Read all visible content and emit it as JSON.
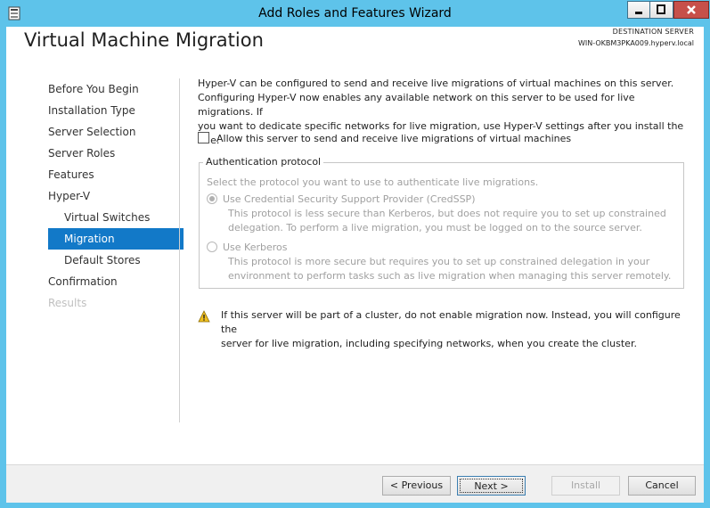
{
  "window": {
    "title": "Add Roles and Features Wizard"
  },
  "header": {
    "page_title": "Virtual Machine Migration",
    "destination_label": "DESTINATION SERVER",
    "destination_server": "WIN-OKBM3PKA009.hyperv.local"
  },
  "nav": {
    "items": [
      {
        "label": "Before You Begin"
      },
      {
        "label": "Installation Type"
      },
      {
        "label": "Server Selection"
      },
      {
        "label": "Server Roles"
      },
      {
        "label": "Features"
      },
      {
        "label": "Hyper-V"
      },
      {
        "label": "Virtual Switches"
      },
      {
        "label": "Migration"
      },
      {
        "label": "Default Stores"
      },
      {
        "label": "Confirmation"
      },
      {
        "label": "Results"
      }
    ]
  },
  "content": {
    "intro_line1": "Hyper-V can be configured to send and receive live migrations of virtual machines on this server.",
    "intro_line2": "Configuring Hyper-V now enables any available network on this server to be used for live migrations. If",
    "intro_line3": "you want to dedicate specific networks for live migration, use Hyper-V settings after you install the role.",
    "allow_label": "Allow this server to send and receive live migrations of virtual machines",
    "allow_checked": false,
    "auth_group_title": "Authentication protocol",
    "auth_group_desc": "Select the protocol you want to use to authenticate live migrations.",
    "credssp_label": "Use Credential Security Support Provider (CredSSP)",
    "credssp_desc1": "This protocol is less secure than Kerberos, but does not require you to set up constrained",
    "credssp_desc2": "delegation. To perform a live migration, you must be logged on to the source server.",
    "kerberos_label": "Use Kerberos",
    "kerberos_desc1": "This protocol is more secure but requires you to set up constrained delegation in your",
    "kerberos_desc2": "environment to perform tasks such as live migration when managing this server remotely.",
    "warning_line1": "If this server will be part of a cluster, do not enable migration now. Instead, you will configure the",
    "warning_line2": "server for live migration, including specifying networks, when you create the cluster."
  },
  "footer": {
    "previous_label": "< Previous",
    "next_label": "Next >",
    "install_label": "Install",
    "cancel_label": "Cancel"
  },
  "colors": {
    "title_bar": "#5ec3ea",
    "nav_selected": "#1279c8",
    "close_button": "#c7504a"
  }
}
